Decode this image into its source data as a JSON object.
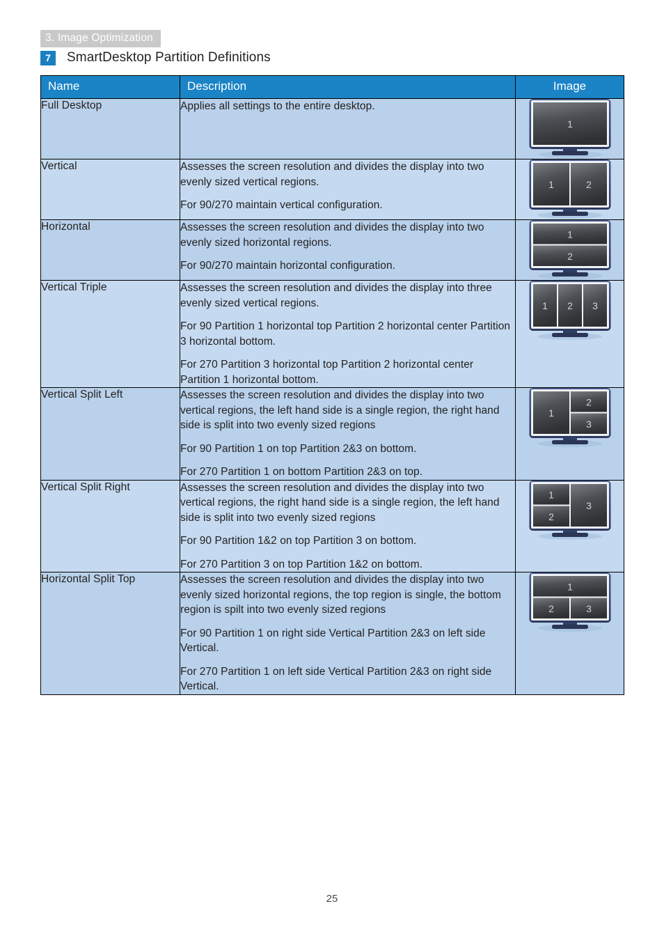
{
  "chapter_tab": "3. Image Optimization",
  "section": {
    "number": "7",
    "title": "SmartDesktop Partition Definitions",
    "accent_color": "#1a7fc1"
  },
  "table": {
    "headers": {
      "name": "Name",
      "description": "Description",
      "image": "Image"
    },
    "header_bg": "#1a84c7",
    "row_tint_a": "#b9d1ea",
    "row_tint_b": "#c5daf0",
    "rows": [
      {
        "name": "Full Desktop",
        "paragraphs": [
          "Applies all settings to the entire desktop."
        ],
        "image": {
          "icon": "monitor-partition-full-desktop",
          "layout": "full",
          "labels": [
            "1"
          ]
        }
      },
      {
        "name": "Vertical",
        "paragraphs": [
          "Assesses the screen resolution and divides the display into two evenly sized vertical regions.",
          "For 90/270 maintain vertical configuration."
        ],
        "image": {
          "icon": "monitor-partition-vertical",
          "layout": "vertical-2",
          "labels": [
            "1",
            "2"
          ]
        }
      },
      {
        "name": "Horizontal",
        "paragraphs": [
          "Assesses the screen resolution and divides the display into two evenly sized horizontal regions.",
          "For 90/270 maintain horizontal configuration."
        ],
        "image": {
          "icon": "monitor-partition-horizontal",
          "layout": "horizontal-2",
          "labels": [
            "1",
            "2"
          ]
        }
      },
      {
        "name": "Vertical Triple",
        "paragraphs": [
          "Assesses the screen resolution and divides the display into three evenly sized vertical regions.",
          "For 90 Partition 1 horizontal top Partition 2 horizontal center Partition 3 horizontal bottom.",
          "For 270 Partition 3 horizontal top Partition 2 horizontal center Partition 1 horizontal bottom."
        ],
        "image": {
          "icon": "monitor-partition-vertical-triple",
          "layout": "vertical-3",
          "labels": [
            "1",
            "2",
            "3"
          ]
        }
      },
      {
        "name": "Vertical Split Left",
        "paragraphs": [
          "Assesses the screen resolution and divides the display into two vertical regions, the left hand side is a single region, the right hand side is split into two evenly sized regions",
          "For 90 Partition 1 on top Partition 2&3 on bottom.",
          "For 270 Partition 1 on bottom Partition 2&3 on top."
        ],
        "image": {
          "icon": "monitor-partition-vertical-split-left",
          "layout": "split-left",
          "labels": [
            "1",
            "2",
            "3"
          ]
        }
      },
      {
        "name": "Vertical Split Right",
        "paragraphs": [
          "Assesses the screen resolution and divides the display into two vertical regions, the right hand side is a single region, the left hand side is split into two evenly sized regions",
          "For 90 Partition 1&2 on top Partition 3 on bottom.",
          "For 270 Partition 3 on top Partition 1&2 on bottom."
        ],
        "image": {
          "icon": "monitor-partition-vertical-split-right",
          "layout": "split-right",
          "labels": [
            "1",
            "2",
            "3"
          ]
        }
      },
      {
        "name": "Horizontal Split Top",
        "paragraphs": [
          "Assesses the screen resolution and divides the display into two evenly sized horizontal regions, the top region is single, the bottom region is spilt into two evenly sized regions",
          "For 90 Partition 1 on right side Vertical Partition 2&3 on left side Vertical.",
          "For 270 Partition 1 on left side Vertical Partition 2&3 on right side Vertical."
        ],
        "image": {
          "icon": "monitor-partition-horizontal-split-top",
          "layout": "hsplit-top",
          "labels": [
            "1",
            "2",
            "3"
          ]
        }
      }
    ]
  },
  "footer": {
    "page_number": "25"
  }
}
